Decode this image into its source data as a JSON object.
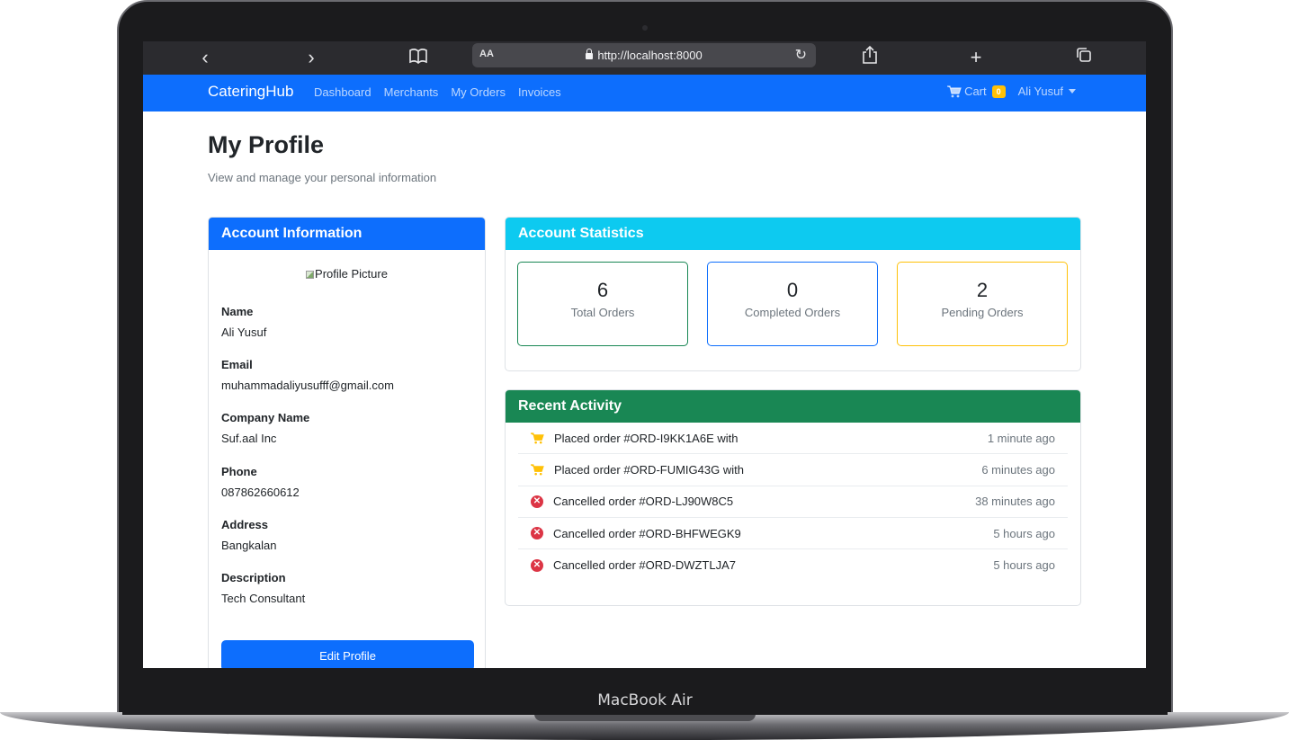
{
  "device": {
    "brand_label": "MacBook Air"
  },
  "browser": {
    "url": "http://localhost:8000",
    "aa_label": "AA"
  },
  "navbar": {
    "brand": "CateringHub",
    "links": [
      "Dashboard",
      "Merchants",
      "My Orders",
      "Invoices"
    ],
    "cart_label": "Cart",
    "cart_count": "0",
    "user_name": "Ali Yusuf"
  },
  "page": {
    "title": "My Profile",
    "subtitle": "View and manage your personal information"
  },
  "account": {
    "header": "Account Information",
    "profile_picture_alt": "Profile Picture",
    "fields": [
      {
        "label": "Name",
        "value": "Ali Yusuf"
      },
      {
        "label": "Email",
        "value": "muhammadaliyusufff@gmail.com"
      },
      {
        "label": "Company Name",
        "value": "Suf.aal Inc"
      },
      {
        "label": "Phone",
        "value": "087862660612"
      },
      {
        "label": "Address",
        "value": "Bangkalan"
      },
      {
        "label": "Description",
        "value": "Tech Consultant"
      }
    ],
    "edit_button": "Edit Profile"
  },
  "stats": {
    "header": "Account Statistics",
    "items": [
      {
        "value": "6",
        "label": "Total Orders",
        "border_color": "#198754"
      },
      {
        "value": "0",
        "label": "Completed Orders",
        "border_color": "#0d6efd"
      },
      {
        "value": "2",
        "label": "Pending Orders",
        "border_color": "#ffc107"
      }
    ]
  },
  "activity": {
    "header": "Recent Activity",
    "items": [
      {
        "icon": "cart-icon",
        "text": "Placed order #ORD-I9KK1A6E with",
        "time": "1 minute ago"
      },
      {
        "icon": "cart-icon",
        "text": "Placed order #ORD-FUMIG43G with",
        "time": "6 minutes ago"
      },
      {
        "icon": "x-circle-icon",
        "text": "Cancelled order #ORD-LJ90W8C5",
        "time": "38 minutes ago"
      },
      {
        "icon": "x-circle-icon",
        "text": "Cancelled order #ORD-BHFWEGK9",
        "time": "5 hours ago"
      },
      {
        "icon": "x-circle-icon",
        "text": "Cancelled order #ORD-DWZTLJA7",
        "time": "5 hours ago"
      }
    ]
  },
  "colors": {
    "primary": "#0d6efd",
    "info": "#0dcaf0",
    "success": "#198754",
    "warning": "#ffc107",
    "danger": "#dc3545"
  }
}
